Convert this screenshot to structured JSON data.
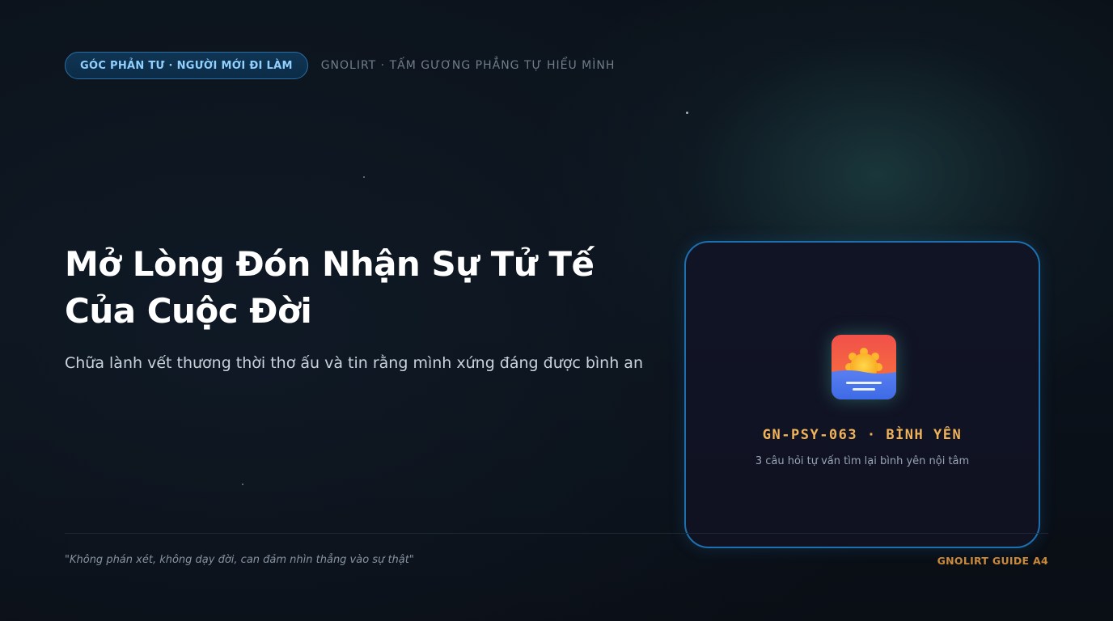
{
  "header": {
    "badge": "GÓC PHẢN TƯ · NGƯỜI MỚI ĐI LÀM",
    "brand_line": "GNOLIRT · TẤM GƯƠNG PHẲNG TỰ HIỂU MÌNH"
  },
  "hero": {
    "title_line1": "Mở Lòng Đón Nhận Sự Tử Tế",
    "title_line2": "Của Cuộc Đời",
    "subtitle": "Chữa lành vết thương thời thơ ấu và tin rằng mình xứng đáng được bình an"
  },
  "card": {
    "icon": "sunset-over-water-icon",
    "code": "GN-PSY-063 · BÌNH YÊN",
    "description": "3 câu hỏi tự vấn tìm lại bình yên nội tâm"
  },
  "footer": {
    "quote": "\"Không phán xét, không dạy đời, can đảm nhìn thẳng vào sự thật\"",
    "brand": "GNOLIRT GUIDE A4"
  },
  "colors": {
    "accent_blue": "#1d6fae",
    "badge_text": "#8fd0ff",
    "accent_gold": "#f0b35a",
    "footer_gold": "#c98a3c"
  }
}
